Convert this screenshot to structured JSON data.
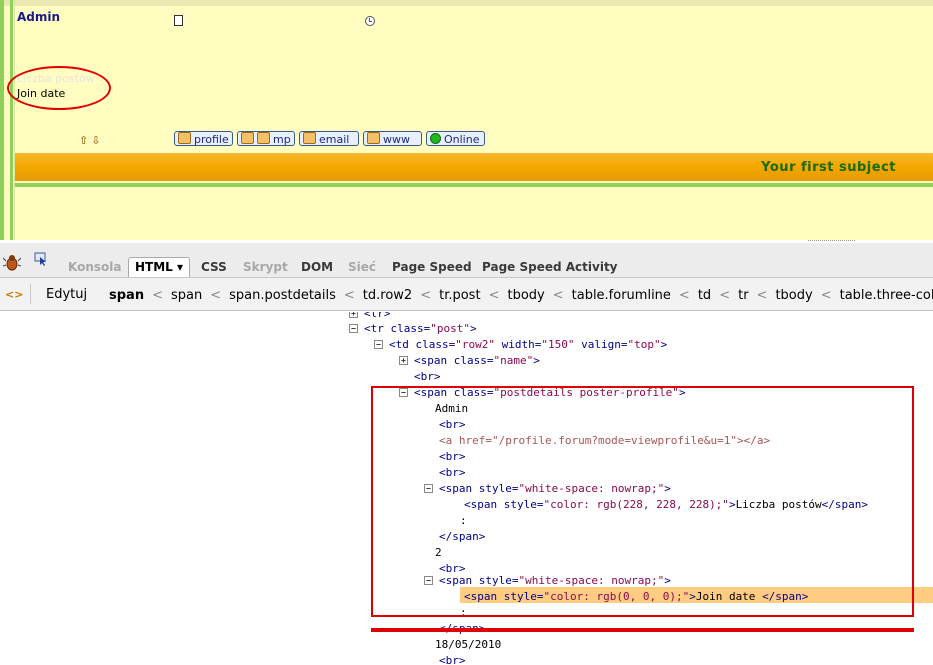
{
  "forum": {
    "username": "Admin",
    "posts_label": "Liczba postów",
    "join_label": "Join date",
    "arrows": "⇧⇩",
    "buttons": {
      "profile": "profile",
      "mp": "mp",
      "email": "email",
      "www": "www",
      "online": "Online"
    },
    "subject": "Your first subject"
  },
  "devtools": {
    "tabs": {
      "console": "Konsola",
      "html": "HTML ▾",
      "css": "CSS",
      "script": "Skrypt",
      "dom": "DOM",
      "net": "Sieć",
      "page_speed": "Page Speed",
      "page_speed_activity": "Page Speed Activity"
    },
    "edit_label": "Edytuj",
    "breadcrumbs": [
      "span",
      "span",
      "span.postdetails",
      "td.row2",
      "tr.post",
      "tbody",
      "table.forumline",
      "td",
      "tr",
      "tbody",
      "table.three-col"
    ],
    "tree": {
      "l0": "<tr>",
      "l1_tag": "<tr ",
      "l1_attr": "class=",
      "l1_val": "\"post\"",
      "l1_end": ">",
      "l2_tag": "<td ",
      "l2_a1": "class=",
      "l2_v1": "\"row2\"",
      "l2_a2": " width=",
      "l2_v2": "\"150\"",
      "l2_a3": " valign=",
      "l2_v3": "\"top\"",
      "l2_end": ">",
      "l3_tag": "<span ",
      "l3_attr": "class=",
      "l3_val": "\"name\"",
      "l3_end": ">",
      "l4": "<br>",
      "l5_tag": "<span ",
      "l5_attr": "class=",
      "l5_val": "\"postdetails poster-profile\"",
      "l5_end": ">",
      "l6": "Admin",
      "l7": "<br>",
      "l8": "<a href=\"/profile.forum?mode=viewprofile&u=1\"></a>",
      "l9": "<br>",
      "l10": "<br>",
      "l11_tag": "<span ",
      "l11_attr": "style=",
      "l11_val": "\"white-space: nowrap;\"",
      "l11_end": ">",
      "l12_tag": "<span ",
      "l12_attr": "style=",
      "l12_val": "\"color: rgb(228, 228, 228);\"",
      "l12_mid": ">",
      "l12_text": "Liczba postów",
      "l12_end": "</span>",
      "l13": ":",
      "l14": "</span>",
      "l15": "2",
      "l16": "<br>",
      "l17_tag": "<span ",
      "l17_attr": "style=",
      "l17_val": "\"white-space: nowrap;\"",
      "l17_end": ">",
      "l18_tag": "<span ",
      "l18_attr": "style=",
      "l18_val": "\"color: rgb(0, 0, 0);\"",
      "l18_mid": ">",
      "l18_text": "Join date ",
      "l18_end": "</span>",
      "l19": ":",
      "l20": "</span>",
      "l21": "18/05/2010",
      "l22": "<br>"
    }
  },
  "colors": {
    "forum_bg": "#fffdc0",
    "green_accent": "#8fd05a",
    "orange_bar": "#f6a800",
    "subject_text": "#166b06",
    "annotation_red": "#e00000",
    "tree_highlight": "#ffcc82"
  },
  "icons": [
    "post-icon",
    "clock-icon",
    "sort-arrows-icon",
    "profile-icon",
    "mp-icon",
    "email-icon",
    "www-icon",
    "online-icon",
    "firebug-icon",
    "inspect-icon",
    "breadcrumb-expand-icon",
    "twisty-icon"
  ]
}
